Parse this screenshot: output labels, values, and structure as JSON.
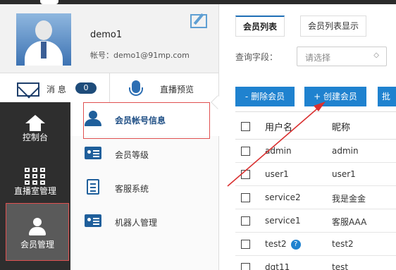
{
  "profile": {
    "username": "demo1",
    "account": "帐号：demo1@91mp.com"
  },
  "quickbar": {
    "messages_label": "消 息",
    "messages_count": "0",
    "live_preview_label": "直播预览"
  },
  "leftnav": {
    "items": [
      {
        "label": "控制台",
        "icon": "home-icon"
      },
      {
        "label": "直播室管理",
        "icon": "grid-icon"
      },
      {
        "label": "会员管理",
        "icon": "user-icon",
        "active": true
      }
    ]
  },
  "subnav": {
    "items": [
      {
        "label": "会员帐号信息",
        "icon": "user-icon",
        "active": true
      },
      {
        "label": "会员等级",
        "icon": "id-card-icon"
      },
      {
        "label": "客服系统",
        "icon": "clipboard-icon"
      },
      {
        "label": "机器人管理",
        "icon": "id-card-icon"
      }
    ]
  },
  "main": {
    "tabs": [
      {
        "label": "会员列表",
        "active": true
      },
      {
        "label": "会员列表显示"
      }
    ],
    "query_label": "查询字段：",
    "query_select_value": "请选择",
    "buttons": {
      "delete": "- 删除会员",
      "create": "+ 创建会员",
      "batch": "批"
    },
    "table": {
      "headers": [
        "用户名",
        "昵称"
      ],
      "rows": [
        {
          "username": "admin",
          "nickname": "admin"
        },
        {
          "username": "user1",
          "nickname": "user1"
        },
        {
          "username": "service2",
          "nickname": "我是金金"
        },
        {
          "username": "service1",
          "nickname": "客服AAA"
        },
        {
          "username": "test2",
          "nickname": "test2",
          "help": "?"
        },
        {
          "username": "dgt11",
          "nickname": "test"
        }
      ]
    }
  },
  "colors": {
    "accent": "#1f82cf",
    "highlight_border": "#e05050",
    "nav_dark": "#2e2e2e"
  }
}
